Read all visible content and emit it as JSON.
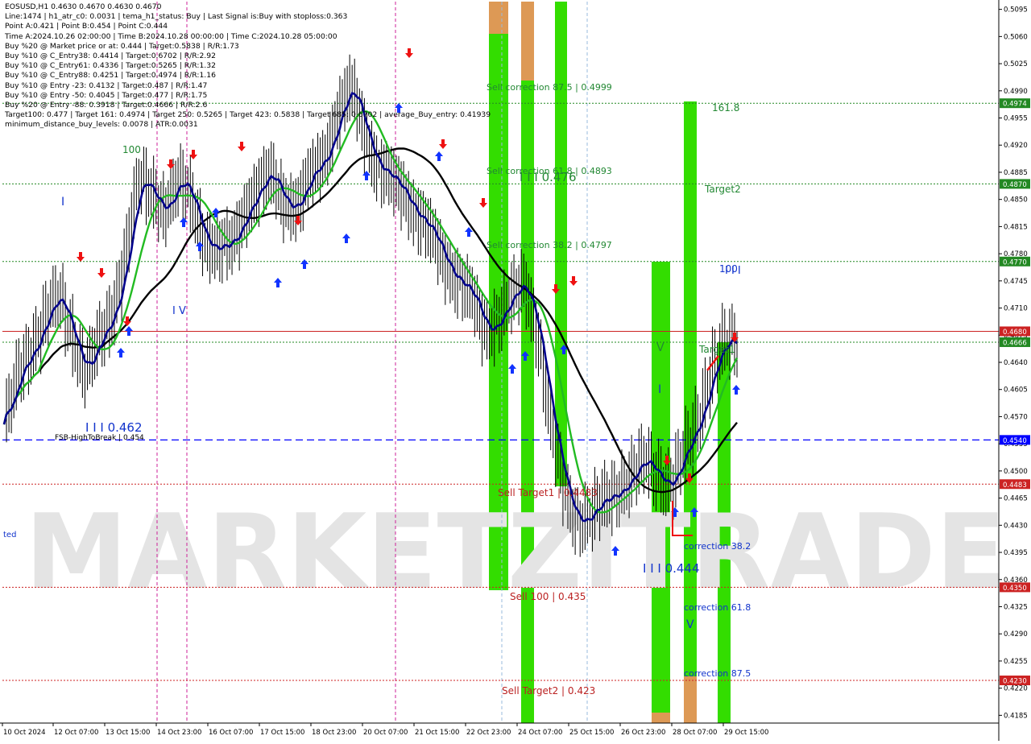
{
  "header": {
    "symbol_line": "EOSUSD,H1  0.4630 0.4670 0.4630 0.4670",
    "lines": [
      "Line:1474  |  h1_atr_c0: 0.0031  |  tema_h1_status: Buy  |  Last Signal is:Buy with stoploss:0.363",
      "Point A:0.421  |  Point B:0.454  |  Point C:0.444",
      "Time A:2024.10.26 02:00:00  |  Time B:2024.10.28 00:00:00  |  Time C:2024.10.28 05:00:00",
      "Buy %20 @ Market price or at: 0.444  |  Target:0.5838  |  R/R:1.73",
      "Buy %10 @ C_Entry38: 0.4414  |  Target:0.6702  |  R/R:2.92",
      "Buy %10 @ C_Entry61: 0.4336  |  Target:0.5265  |  R/R:1.32",
      "Buy %10 @ C_Entry88: 0.4251  |  Target:0.4974  |  R/R:1.16",
      "Buy %10 @ Entry -23: 0.4132  |  Target:0.487  |  R/R:1.47",
      "Buy %10 @ Entry -50: 0.4045  |  Target:0.477  |  R/R:1.75",
      "Buy %20 @ Entry -88: 0.3918  |  Target:0.4666  |  R/R:2.6",
      "Target100: 0.477  |  Target 161: 0.4974  |  Target 250: 0.5265  |  Target 423: 0.5838  |  Target 685: 0.6702  |  average_Buy_entry: 0.41939",
      "minimum_distance_buy_levels: 0.0078  |  ATR:0.0031"
    ]
  },
  "watermark": "MARKETZITRADE",
  "colors": {
    "green_zone": "#33dd00",
    "orange_zone": "#dd9955",
    "sell_label": "#bb2222",
    "buy_label": "#1133cc",
    "target_label": "#228833",
    "level_red": "#cc2222",
    "level_blue": "#0000ff",
    "level_green": "#228822",
    "ma_black": "#000000",
    "ma_green": "#22bb22",
    "ma_navy": "#00008b"
  },
  "chart_data": {
    "type": "candlestick",
    "title": "EOSUSD,H1",
    "ylim": [
      0.4175,
      0.5105
    ],
    "yticks": [
      "0.5095",
      "0.5060",
      "0.5025",
      "0.4990",
      "0.4955",
      "0.4920",
      "0.4885",
      "0.4850",
      "0.4815",
      "0.4780",
      "0.4745",
      "0.4710",
      "0.4675",
      "0.4640",
      "0.4605",
      "0.4570",
      "0.4535",
      "0.4500",
      "0.4465",
      "0.4430",
      "0.4395",
      "0.4360",
      "0.4325",
      "0.4290",
      "0.4255",
      "0.4220",
      "0.4185"
    ],
    "xticks": [
      "10 Oct 2024",
      "12 Oct 07:00",
      "13 Oct 15:00",
      "14 Oct 23:00",
      "16 Oct 07:00",
      "17 Oct 15:00",
      "18 Oct 23:00",
      "20 Oct 07:00",
      "21 Oct 15:00",
      "22 Oct 23:00",
      "24 Oct 07:00",
      "25 Oct 15:00",
      "26 Oct 23:00",
      "28 Oct 07:00",
      "29 Oct 15:00"
    ],
    "close_trace": [
      0.456,
      0.462,
      0.466,
      0.47,
      0.472,
      0.468,
      0.463,
      0.466,
      0.47,
      0.478,
      0.487,
      0.486,
      0.484,
      0.487,
      0.485,
      0.48,
      0.478,
      0.479,
      0.484,
      0.486,
      0.488,
      0.485,
      0.484,
      0.488,
      0.491,
      0.496,
      0.499,
      0.494,
      0.489,
      0.487,
      0.486,
      0.483,
      0.48,
      0.477,
      0.475,
      0.472,
      0.468,
      0.47,
      0.472,
      0.474,
      0.468,
      0.455,
      0.447,
      0.444,
      0.444,
      0.446,
      0.448,
      0.449,
      0.451,
      0.45,
      0.448,
      0.452,
      0.457,
      0.463,
      0.466,
      0.467
    ],
    "price_levels": [
      {
        "value": "0.4974",
        "kind": "green"
      },
      {
        "value": "0.4870",
        "kind": "green"
      },
      {
        "value": "0.4770",
        "kind": "green"
      },
      {
        "value": "0.4680",
        "kind": "red"
      },
      {
        "value": "0.4666",
        "kind": "green"
      },
      {
        "value": "0.4540",
        "kind": "blue"
      },
      {
        "value": "0.4483",
        "kind": "red"
      },
      {
        "value": "0.4350",
        "kind": "red"
      },
      {
        "value": "0.4230",
        "kind": "red"
      }
    ],
    "annotations": {
      "sell_correction_875": "Sell correction 87.5 | 0.4999",
      "sell_correction_618": "Sell correction 61.8 | 0.4893",
      "sell_correction_382": "Sell correction 38.2 | 0.4797",
      "sell_target1": "Sell Target1 | 0.4483",
      "sell_100": "Sell 100 | 0.435",
      "sell_target2": "Sell Target2 | 0.423",
      "wave_0476": "I I I 0.476",
      "wave_0462": "I I I 0.462",
      "wave_0444": "I I I 0.444",
      "fsb": "FSB-HighToBreak  |  0.454",
      "t1618": "161.8",
      "target2": "Target2",
      "target1": "Target1",
      "hundred_left": "100",
      "hundred_right": "100",
      "corr382": "correction 38.2",
      "corr618": "correction 61.8",
      "corr875": "correction 87.5",
      "v_label": "V",
      "i_label": "I",
      "iii_label": "I I I",
      "iv_label": "I V",
      "ted": "ted"
    }
  }
}
